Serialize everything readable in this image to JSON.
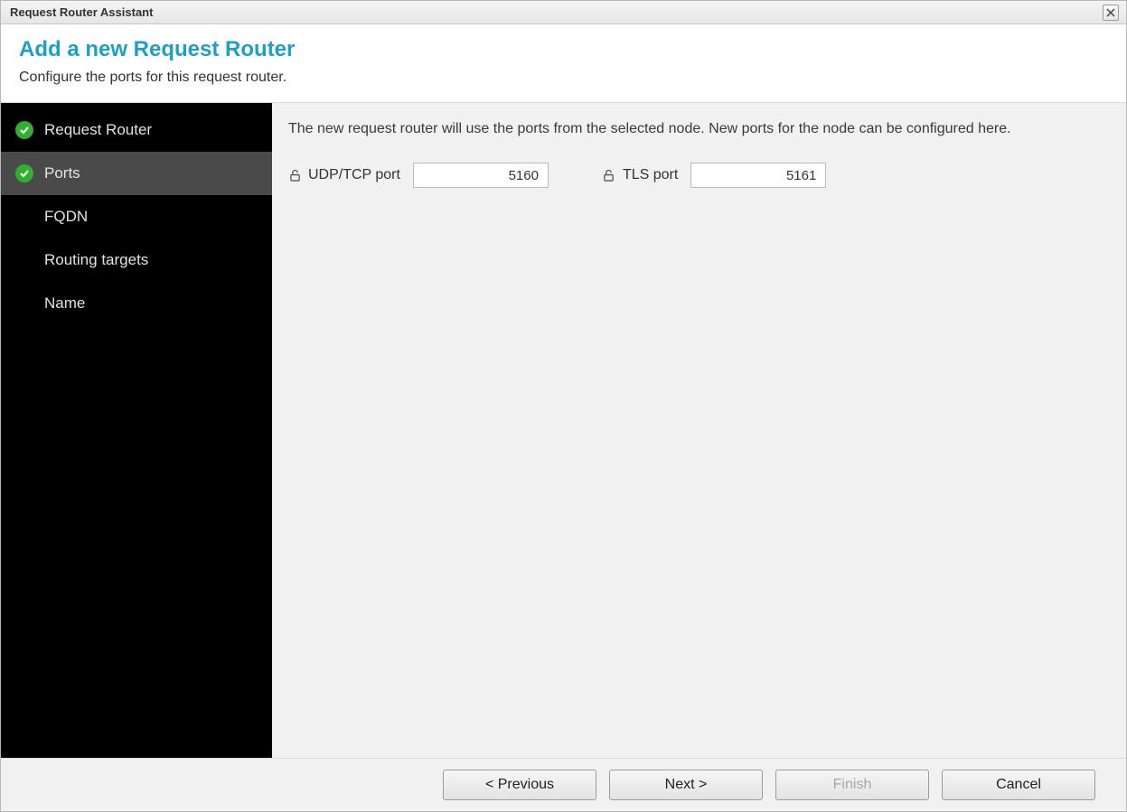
{
  "window": {
    "title": "Request Router Assistant"
  },
  "header": {
    "title": "Add a new Request Router",
    "subtitle": "Configure the ports for this request router."
  },
  "sidebar": {
    "items": [
      {
        "label": "Request Router",
        "done": true,
        "active": false
      },
      {
        "label": "Ports",
        "done": true,
        "active": true
      },
      {
        "label": "FQDN",
        "done": false,
        "active": false
      },
      {
        "label": "Routing targets",
        "done": false,
        "active": false
      },
      {
        "label": "Name",
        "done": false,
        "active": false
      }
    ]
  },
  "content": {
    "description": "The new request router will use the ports from the selected node. New ports for the node can be configured here.",
    "fields": {
      "udp_tcp": {
        "label": "UDP/TCP port",
        "value": "5160"
      },
      "tls": {
        "label": "TLS port",
        "value": "5161"
      }
    }
  },
  "footer": {
    "previous": "< Previous",
    "next": "Next >",
    "finish": "Finish",
    "cancel": "Cancel",
    "finish_enabled": false
  }
}
